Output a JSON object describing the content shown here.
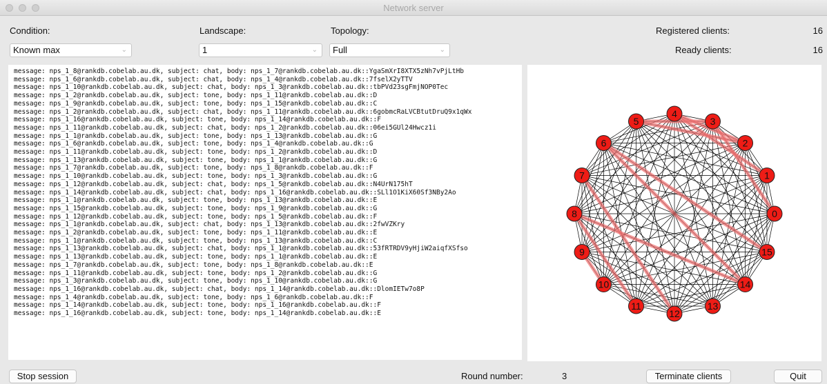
{
  "window": {
    "title": "Network server"
  },
  "controls": {
    "condition_label": "Condition:",
    "condition_value": "Known max",
    "landscape_label": "Landscape:",
    "landscape_value": "1",
    "topology_label": "Topology:",
    "topology_value": "Full",
    "registered_label": "Registered clients:",
    "registered_value": "16",
    "ready_label": "Ready clients:",
    "ready_value": "16"
  },
  "log": [
    "message: nps_1_8@rankdb.cobelab.au.dk, subject: chat, body: nps_1_7@rankdb.cobelab.au.dk::YgaSmXrI8XTX5zNh7vPjLtHb",
    "message: nps_1_6@rankdb.cobelab.au.dk, subject: chat, body: nps_1_4@rankdb.cobelab.au.dk::7fselX2yTTV",
    "message: nps_1_10@rankdb.cobelab.au.dk, subject: chat, body: nps_1_3@rankdb.cobelab.au.dk::tbPVd23sgFmjNOP0Tec",
    "message: nps_1_2@rankdb.cobelab.au.dk, subject: tone, body: nps_1_11@rankdb.cobelab.au.dk::D",
    "message: nps_1_9@rankdb.cobelab.au.dk, subject: tone, body: nps_1_15@rankdb.cobelab.au.dk::C",
    "message: nps_1_2@rankdb.cobelab.au.dk, subject: chat, body: nps_1_11@rankdb.cobelab.au.dk::6gobmcRaLVCBtutDruQ9x1qWx",
    "message: nps_1_16@rankdb.cobelab.au.dk, subject: tone, body: nps_1_14@rankdb.cobelab.au.dk::F",
    "message: nps_1_11@rankdb.cobelab.au.dk, subject: chat, body: nps_1_2@rankdb.cobelab.au.dk::06ei5GUl24Hwcz1i",
    "message: nps_1_1@rankdb.cobelab.au.dk, subject: tone, body: nps_1_13@rankdb.cobelab.au.dk::G",
    "message: nps_1_6@rankdb.cobelab.au.dk, subject: tone, body: nps_1_4@rankdb.cobelab.au.dk::G",
    "message: nps_1_11@rankdb.cobelab.au.dk, subject: tone, body: nps_1_2@rankdb.cobelab.au.dk::D",
    "message: nps_1_13@rankdb.cobelab.au.dk, subject: tone, body: nps_1_1@rankdb.cobelab.au.dk::G",
    "message: nps_1_7@rankdb.cobelab.au.dk, subject: tone, body: nps_1_8@rankdb.cobelab.au.dk::F",
    "message: nps_1_10@rankdb.cobelab.au.dk, subject: tone, body: nps_1_3@rankdb.cobelab.au.dk::G",
    "message: nps_1_12@rankdb.cobelab.au.dk, subject: chat, body: nps_1_5@rankdb.cobelab.au.dk::N4UrN175hT",
    "message: nps_1_14@rankdb.cobelab.au.dk, subject: chat, body: nps_1_16@rankdb.cobelab.au.dk::SLl1O1KiX60Sf3NBy2Ao",
    "message: nps_1_1@rankdb.cobelab.au.dk, subject: tone, body: nps_1_13@rankdb.cobelab.au.dk::E",
    "message: nps_1_15@rankdb.cobelab.au.dk, subject: tone, body: nps_1_9@rankdb.cobelab.au.dk::G",
    "message: nps_1_12@rankdb.cobelab.au.dk, subject: tone, body: nps_1_5@rankdb.cobelab.au.dk::F",
    "message: nps_1_1@rankdb.cobelab.au.dk, subject: chat, body: nps_1_13@rankdb.cobelab.au.dk::2fwVZKry",
    "message: nps_1_2@rankdb.cobelab.au.dk, subject: tone, body: nps_1_11@rankdb.cobelab.au.dk::E",
    "message: nps_1_1@rankdb.cobelab.au.dk, subject: tone, body: nps_1_13@rankdb.cobelab.au.dk::C",
    "message: nps_1_13@rankdb.cobelab.au.dk, subject: chat, body: nps_1_1@rankdb.cobelab.au.dk::53fRTRDV9yHjiW2aiqfXSfso",
    "message: nps_1_13@rankdb.cobelab.au.dk, subject: tone, body: nps_1_1@rankdb.cobelab.au.dk::E",
    "message: nps_1_7@rankdb.cobelab.au.dk, subject: tone, body: nps_1_8@rankdb.cobelab.au.dk::E",
    "message: nps_1_11@rankdb.cobelab.au.dk, subject: tone, body: nps_1_2@rankdb.cobelab.au.dk::G",
    "message: nps_1_3@rankdb.cobelab.au.dk, subject: tone, body: nps_1_10@rankdb.cobelab.au.dk::G",
    "message: nps_1_16@rankdb.cobelab.au.dk, subject: chat, body: nps_1_14@rankdb.cobelab.au.dk::DlomIETw7o8P",
    "message: nps_1_4@rankdb.cobelab.au.dk, subject: tone, body: nps_1_6@rankdb.cobelab.au.dk::F",
    "message: nps_1_14@rankdb.cobelab.au.dk, subject: tone, body: nps_1_16@rankdb.cobelab.au.dk::F",
    "message: nps_1_16@rankdb.cobelab.au.dk, subject: tone, body: nps_1_14@rankdb.cobelab.au.dk::E"
  ],
  "network": {
    "node_labels": [
      "0",
      "1",
      "2",
      "3",
      "4",
      "5",
      "6",
      "7",
      "8",
      "9",
      "10",
      "11",
      "12",
      "13",
      "14",
      "15"
    ],
    "highlighted_edges": [
      [
        4,
        2
      ],
      [
        5,
        3
      ],
      [
        4,
        1
      ],
      [
        3,
        0
      ],
      [
        6,
        15
      ],
      [
        6,
        14
      ],
      [
        8,
        14
      ],
      [
        7,
        12
      ],
      [
        8,
        11
      ],
      [
        9,
        10
      ],
      [
        5,
        2
      ]
    ],
    "node_color": "#ee1c16",
    "edge_color": "#000000",
    "highlight_color": "#f07070"
  },
  "footer": {
    "stop_label": "Stop session",
    "round_label": "Round number:",
    "round_value": "3",
    "terminate_label": "Terminate clients",
    "quit_label": "Quit"
  }
}
